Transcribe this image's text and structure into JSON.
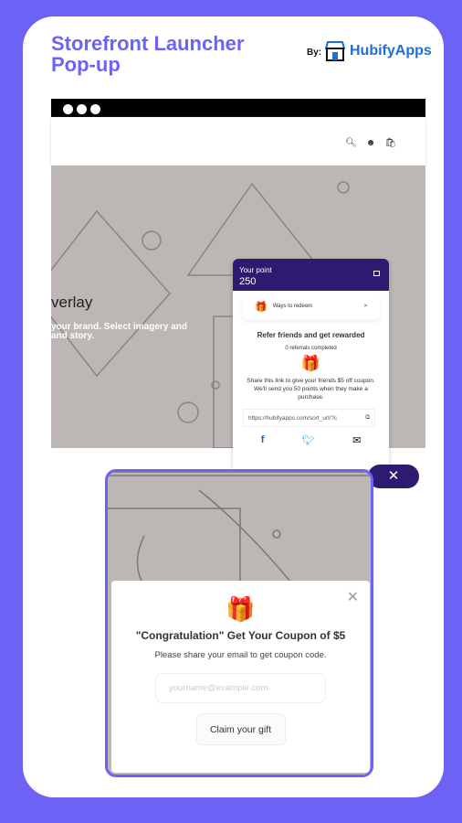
{
  "header": {
    "title_line1": "Storefront Launcher",
    "title_line2": "Pop-up",
    "by": "By:",
    "brand": "HubifyApps"
  },
  "store": {
    "hero_heading": "verlay",
    "hero_text_line1": "your brand. Select imagery and",
    "hero_text_line2": "and story."
  },
  "widget": {
    "point_label": "Your point",
    "points": "250",
    "ways_to_redeem": "Ways to redeem",
    "refer_title": "Refer friends and get rewarded",
    "referrals": "0 referrals completed",
    "description": "Share this link to give your friends $5 off coupon. We'll send you 50 points when they make a purchase.",
    "link": "https://hubifyapps.com/sort_url/?c"
  },
  "popup": {
    "title": "\"Congratulation\" Get Your Coupon of $5",
    "subtitle": "Please share your email to get coupon code.",
    "email_placeholder": "yourname@example.com",
    "claim_button": "Claim your gift"
  },
  "colors": {
    "accent": "#6c63f6",
    "widget_header": "#2e1a6e",
    "hero_bg": "#bcb6b5"
  }
}
